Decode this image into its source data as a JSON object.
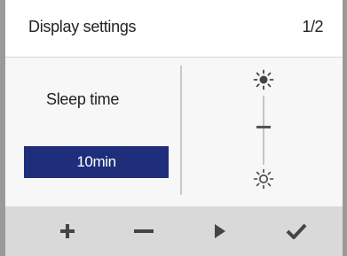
{
  "header": {
    "title": "Display settings",
    "page": "1/2"
  },
  "setting": {
    "label": "Sleep time",
    "value": "10min"
  },
  "brightness": {
    "top_icon": "sun-filled-icon",
    "bottom_icon": "sun-outline-icon",
    "level": 0.45
  },
  "footer": {
    "buttons": [
      {
        "icon": "plus-icon"
      },
      {
        "icon": "minus-icon"
      },
      {
        "icon": "play-icon"
      },
      {
        "icon": "check-icon"
      }
    ]
  },
  "colors": {
    "selected_value_bg": "#1f2e7a",
    "footer_bg": "#d9d9d9",
    "screen_bg": "#f7f7f7"
  }
}
